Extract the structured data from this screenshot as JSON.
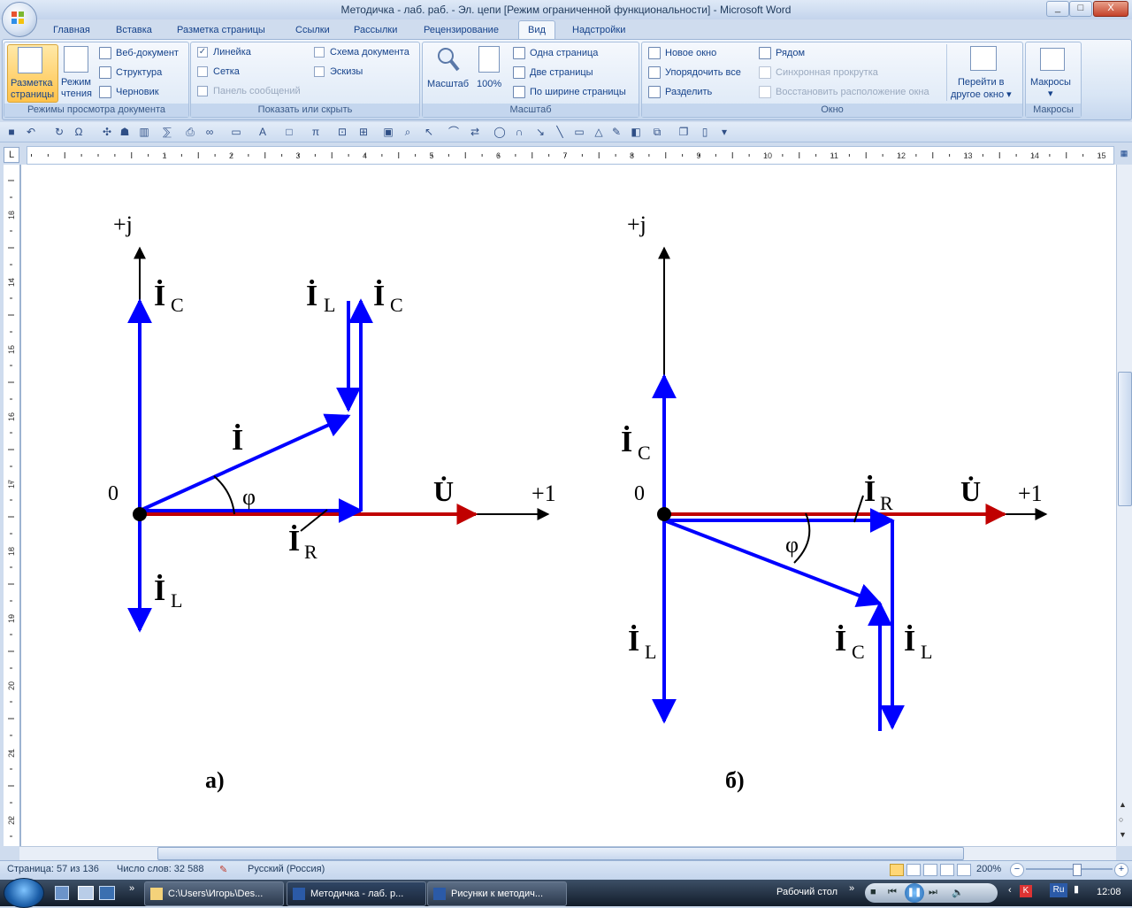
{
  "window": {
    "title": "Методичка - лаб. раб. - Эл. цепи [Режим ограниченной функциональности] - Microsoft Word",
    "min": "_",
    "max": "□",
    "close": "X"
  },
  "tabs": [
    "Главная",
    "Вставка",
    "Разметка страницы",
    "Ссылки",
    "Рассылки",
    "Рецензирование",
    "Вид",
    "Надстройки"
  ],
  "active_tab": "Вид",
  "ribbon": {
    "views": {
      "label": "Режимы просмотра документа",
      "layout_line1": "Разметка",
      "layout_line2": "страницы",
      "reading_line1": "Режим",
      "reading_line2": "чтения",
      "web": "Веб-документ",
      "outline": "Структура",
      "draft": "Черновик"
    },
    "show": {
      "label": "Показать или скрыть",
      "ruler": "Линейка",
      "grid": "Сетка",
      "message_bar": "Панель сообщений",
      "doc_map": "Схема документа",
      "thumbnails": "Эскизы"
    },
    "zoom": {
      "label": "Масштаб",
      "zoom": "Масштаб",
      "hundred": "100%",
      "one_page": "Одна страница",
      "two_pages": "Две страницы",
      "page_width": "По ширине страницы"
    },
    "window": {
      "label": "Окно",
      "new_window": "Новое окно",
      "arrange_all": "Упорядочить все",
      "split": "Разделить",
      "side_by_side": "Рядом",
      "sync_scroll": "Синхронная прокрутка",
      "reset_pos": "Восстановить расположение окна",
      "switch_line1": "Перейти в",
      "switch_line2": "другое окно"
    },
    "macros": {
      "label": "Макросы",
      "button": "Макросы"
    }
  },
  "ruler": {
    "h_ticks": [
      "1",
      "2",
      "3",
      "4",
      "5",
      "6",
      "7",
      "8",
      "9",
      "10",
      "11",
      "12",
      "13",
      "14",
      "15"
    ],
    "v_ticks": [
      "13",
      "14",
      "15",
      "16",
      "17",
      "18",
      "19",
      "20",
      "21",
      "22"
    ]
  },
  "diagram_a": {
    "axis_y": "+j",
    "axis_x": "+1",
    "origin": "0",
    "I_C_left": "İ",
    "I_C_left_sub": "C",
    "I_L_top": "İ",
    "I_L_top_sub": "L",
    "I_C_top": "İ",
    "I_C_top_sub": "C",
    "I": "İ",
    "phi": "φ",
    "U": "U̇",
    "I_R": "İ",
    "I_R_sub": "R",
    "I_L_bottom": "İ",
    "I_L_bottom_sub": "L",
    "caption": "а)"
  },
  "diagram_b": {
    "axis_y": "+j",
    "axis_x": "+1",
    "origin": "0",
    "I_C": "İ",
    "I_C_sub": "C",
    "I_R": "İ",
    "I_R_sub": "R",
    "U": "U̇",
    "phi": "φ",
    "I_L_left": "İ",
    "I_L_left_sub": "L",
    "I_C_bottom": "İ",
    "I_C_bottom_sub": "C",
    "I_L_bottom": "İ",
    "I_L_bottom_sub": "L",
    "caption": "б)"
  },
  "colors": {
    "vector_blue": "#0000ff",
    "voltage_red": "#c00000",
    "axis_black": "#000000"
  },
  "status": {
    "page": "Страница: 57 из 136",
    "words": "Число слов: 32 588",
    "language": "Русский (Россия)",
    "zoom": "200%"
  },
  "taskbar": {
    "btn1": "C:\\Users\\Игорь\\Des...",
    "btn2": "Методичка - лаб. р...",
    "btn3": "Рисунки к методич...",
    "desktop": "Рабочий стол",
    "lang": "Ru",
    "time": "12:08"
  }
}
